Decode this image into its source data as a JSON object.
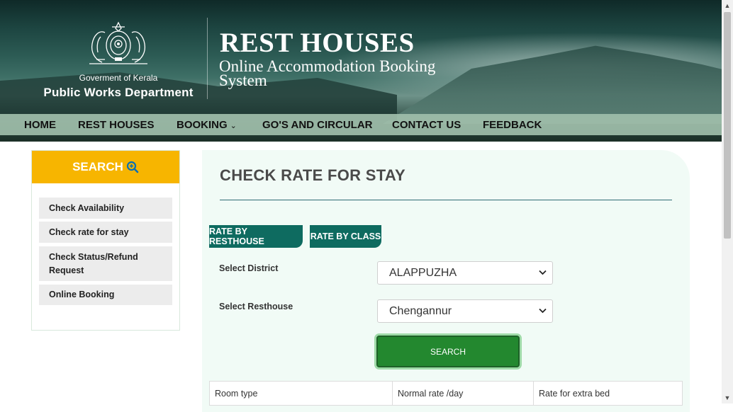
{
  "header": {
    "gov_name": "Goverment of Kerala",
    "dept_name": "Public Works Department",
    "site_title": "REST HOUSES",
    "site_subtitle": "Online Accommodation Booking System",
    "emblem_icon": "kerala-emblem-icon"
  },
  "nav": {
    "items": [
      {
        "label": "HOME"
      },
      {
        "label": "REST HOUSES"
      },
      {
        "label": "BOOKING",
        "icon": "chevron-down-icon"
      },
      {
        "label": "GO'S AND CIRCULAR"
      },
      {
        "label": "CONTACT US"
      },
      {
        "label": "FEEDBACK"
      }
    ]
  },
  "sidebar": {
    "title": "SEARCH",
    "title_icon": "search-plus-icon",
    "items": [
      {
        "label": "Check Availability"
      },
      {
        "label": "Check rate for stay"
      },
      {
        "label": "Check Status/Refund Request"
      },
      {
        "label": "Online Booking"
      }
    ]
  },
  "main": {
    "title": "CHECK RATE FOR STAY",
    "tabs": [
      {
        "label": "RATE BY RESTHOUSE"
      },
      {
        "label": "RATE BY CLASS"
      }
    ],
    "form": {
      "district_label": "Select District",
      "district_value": "ALAPPUZHA",
      "resthouse_label": "Select Resthouse",
      "resthouse_value": "Chengannur",
      "search_button": "SEARCH"
    },
    "table": {
      "headers": [
        "Room type",
        "Normal rate /day",
        "Rate for extra bed"
      ]
    }
  },
  "colors": {
    "search_header": "#f7b500",
    "tab_button": "#0e6b60",
    "search_button": "#23882f",
    "nav_bar": "#a0beaa",
    "panel_bg": "#f1fbf6"
  }
}
